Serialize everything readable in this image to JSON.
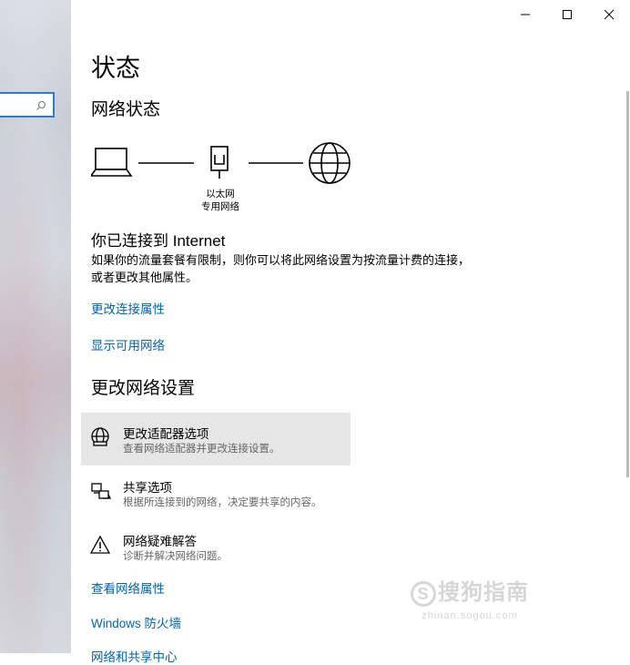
{
  "window": {
    "controls": [
      "minimize",
      "maximize",
      "close"
    ]
  },
  "page": {
    "title": "状态"
  },
  "network_status": {
    "heading": "网络状态",
    "router_label_1": "以太网",
    "router_label_2": "专用网络",
    "connected_title": "你已连接到 Internet",
    "description": "如果你的流量套餐有限制，则你可以将此网络设置为按流量计费的连接，或者更改其他属性。"
  },
  "links": {
    "change_connection_properties": "更改连接属性",
    "show_available_networks": "显示可用网络",
    "view_network_properties": "查看网络属性",
    "windows_firewall": "Windows 防火墙",
    "network_sharing_center_partial": "网络和共享中心"
  },
  "change_settings": {
    "heading": "更改网络设置",
    "options": [
      {
        "title": "更改适配器选项",
        "desc": "查看网络适配器并更改连接设置。",
        "icon": "adapter-globe-icon"
      },
      {
        "title": "共享选项",
        "desc": "根据所连接到的网络，决定要共享的内容。",
        "icon": "sharing-icon"
      },
      {
        "title": "网络疑难解答",
        "desc": "诊断并解决网络问题。",
        "icon": "warning-icon"
      }
    ]
  },
  "watermark": {
    "text": "搜狗指南",
    "url": "zhinan.sogou.com"
  },
  "colors": {
    "link": "#0063b1",
    "accent": "#2f7ad6",
    "highlight": "#e6e6e6"
  }
}
